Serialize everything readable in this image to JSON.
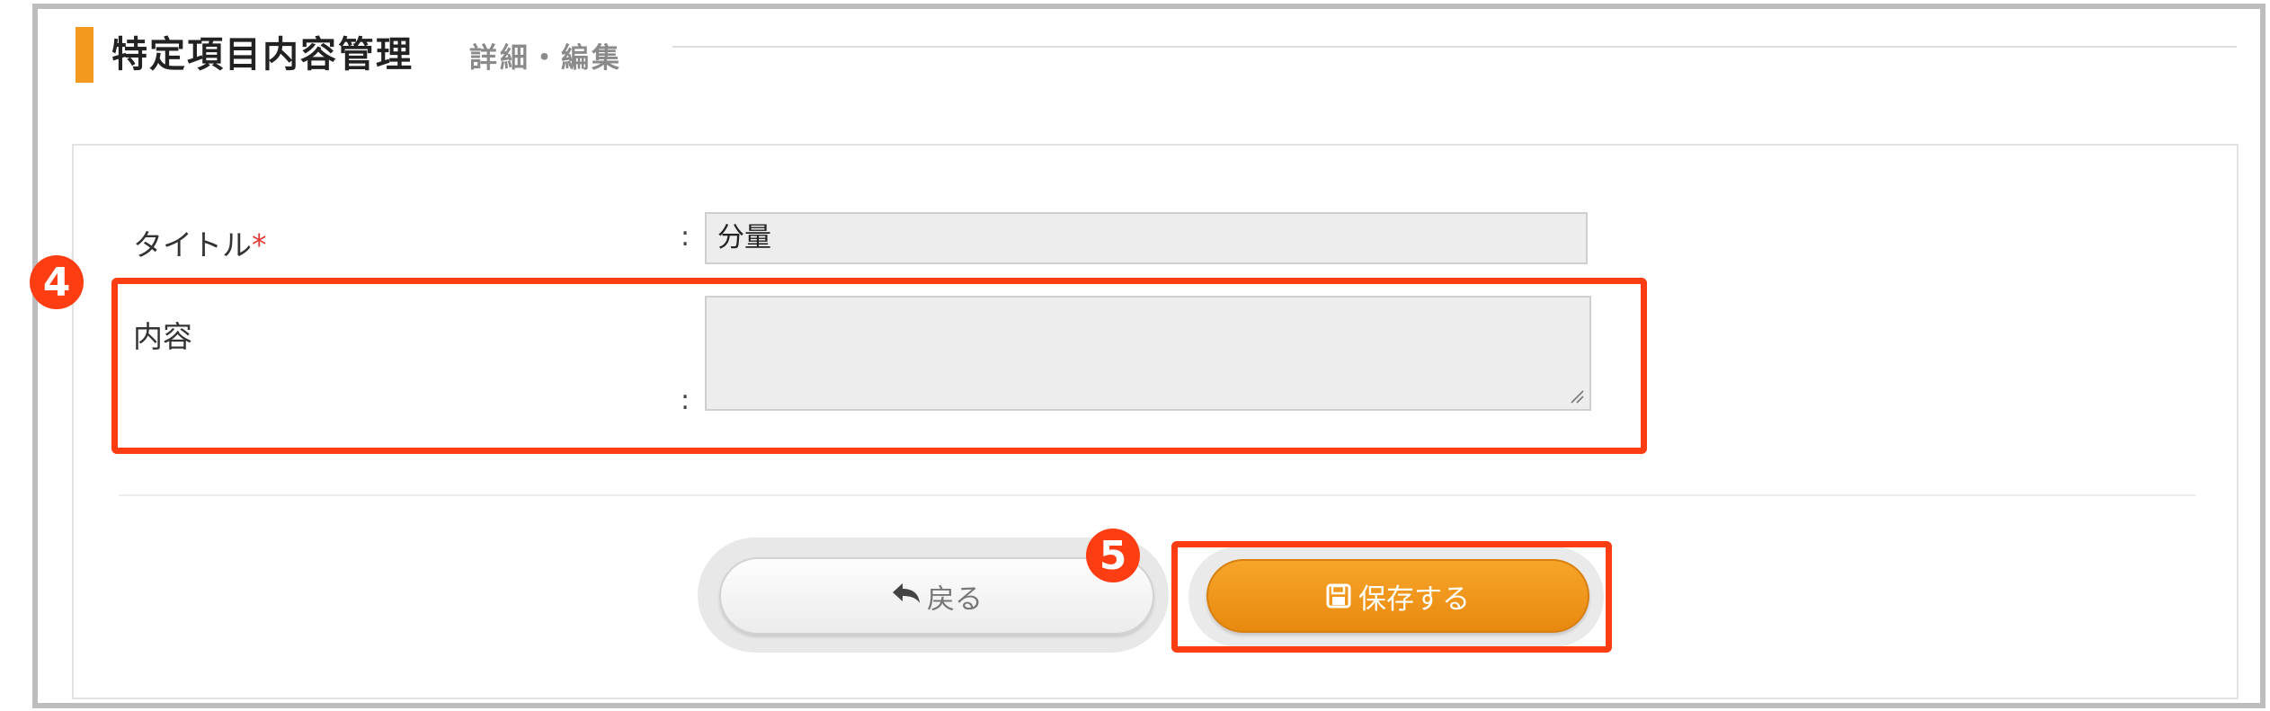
{
  "header": {
    "title": "特定項目内容管理",
    "subtitle": "詳細・編集"
  },
  "form": {
    "title_label": "タイトル",
    "required_mark": "*",
    "title_value": "分量",
    "content_label": "内容",
    "content_value": "",
    "separator": ":"
  },
  "actions": {
    "back_label": "戻る",
    "save_label": "保存する"
  },
  "annotations": {
    "step_4": "4",
    "step_5": "5"
  },
  "colors": {
    "accent": "#f39a1e",
    "save_button": "#f39a1e",
    "highlight": "#ff3d13",
    "required": "#e53935"
  },
  "icons": {
    "back": "reply-arrow-icon",
    "save": "floppy-disk-icon",
    "resize": "resize-grip-icon"
  }
}
